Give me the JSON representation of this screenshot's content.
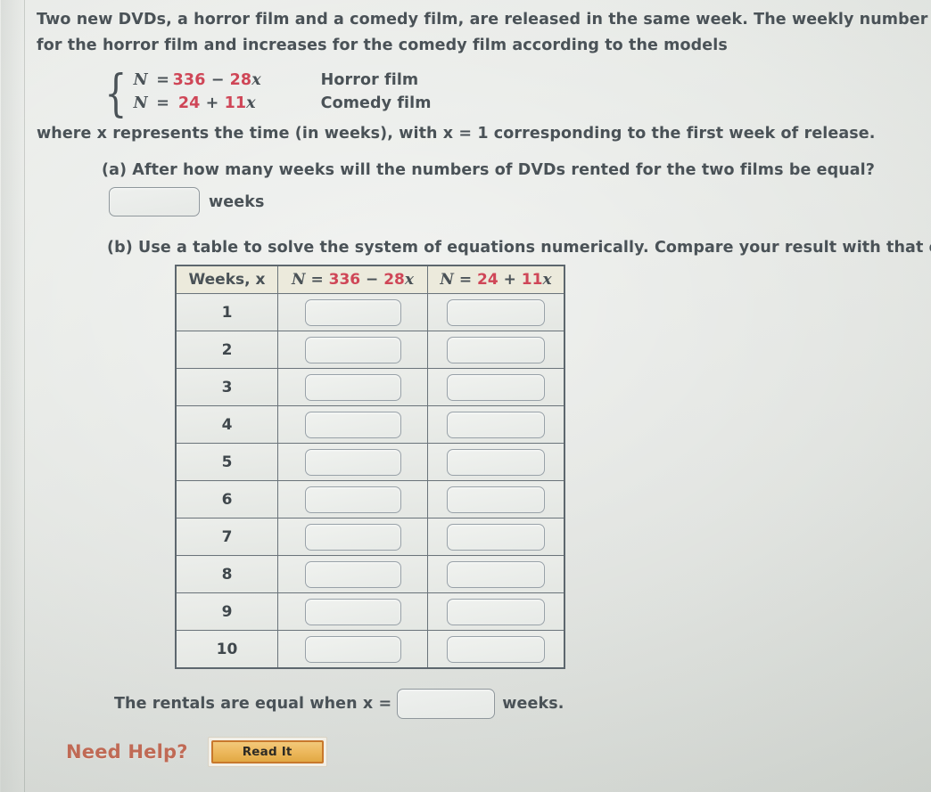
{
  "problem": {
    "intro_line1": "Two new DVDs, a horror film and a comedy film, are released in the same week. The weekly number N of rentals decreases",
    "intro_line2": "for the horror film and increases for the comedy film according to the models",
    "where_line": "where x represents the time (in weeks), with x = 1 corresponding to the first week of release."
  },
  "system": {
    "brace": "{",
    "rows": [
      {
        "lhs": "N",
        "eq": "=",
        "const": "336",
        "op": "−",
        "coef": "28",
        "var": "x",
        "label": "Horror film"
      },
      {
        "lhs": "N",
        "eq": "=",
        "const": "24",
        "op": "+",
        "coef": "11",
        "var": "x",
        "label": "Comedy film"
      }
    ]
  },
  "part_a": {
    "prompt": "(a) After how many weeks will the numbers of DVDs rented for the two films be equal?",
    "answer_value": "",
    "answer_placeholder": "",
    "unit": "weeks"
  },
  "part_b": {
    "prompt": "(b) Use a table to solve the system of equations numerically. Compare your result with that of part (a).",
    "table": {
      "headers": {
        "week_label": "Weeks, x",
        "horror_prefix": "N = ",
        "horror_const": "336",
        "horror_op": " − ",
        "horror_coef": "28",
        "horror_var": "x",
        "comedy_prefix": "N = ",
        "comedy_const": "24",
        "comedy_op": " + ",
        "comedy_coef": "11",
        "comedy_var": "x"
      },
      "rows": [
        {
          "week": "1",
          "horror_value": "",
          "comedy_value": ""
        },
        {
          "week": "2",
          "horror_value": "",
          "comedy_value": ""
        },
        {
          "week": "3",
          "horror_value": "",
          "comedy_value": ""
        },
        {
          "week": "4",
          "horror_value": "",
          "comedy_value": ""
        },
        {
          "week": "5",
          "horror_value": "",
          "comedy_value": ""
        },
        {
          "week": "6",
          "horror_value": "",
          "comedy_value": ""
        },
        {
          "week": "7",
          "horror_value": "",
          "comedy_value": ""
        },
        {
          "week": "8",
          "horror_value": "",
          "comedy_value": ""
        },
        {
          "week": "9",
          "horror_value": "",
          "comedy_value": ""
        },
        {
          "week": "10",
          "horror_value": "",
          "comedy_value": ""
        }
      ]
    }
  },
  "final_answer": {
    "prefix": "The rentals are equal when x =",
    "value": "",
    "suffix": "weeks."
  },
  "help": {
    "label": "Need Help?",
    "read_it_label": "Read It"
  },
  "colors": {
    "number_accent": "#cf4657",
    "text": "#4a5257",
    "need_help": "#c06a55",
    "button_fill": "#edb95e",
    "button_border": "#c8782c",
    "table_header_bg": "#eceadc"
  }
}
